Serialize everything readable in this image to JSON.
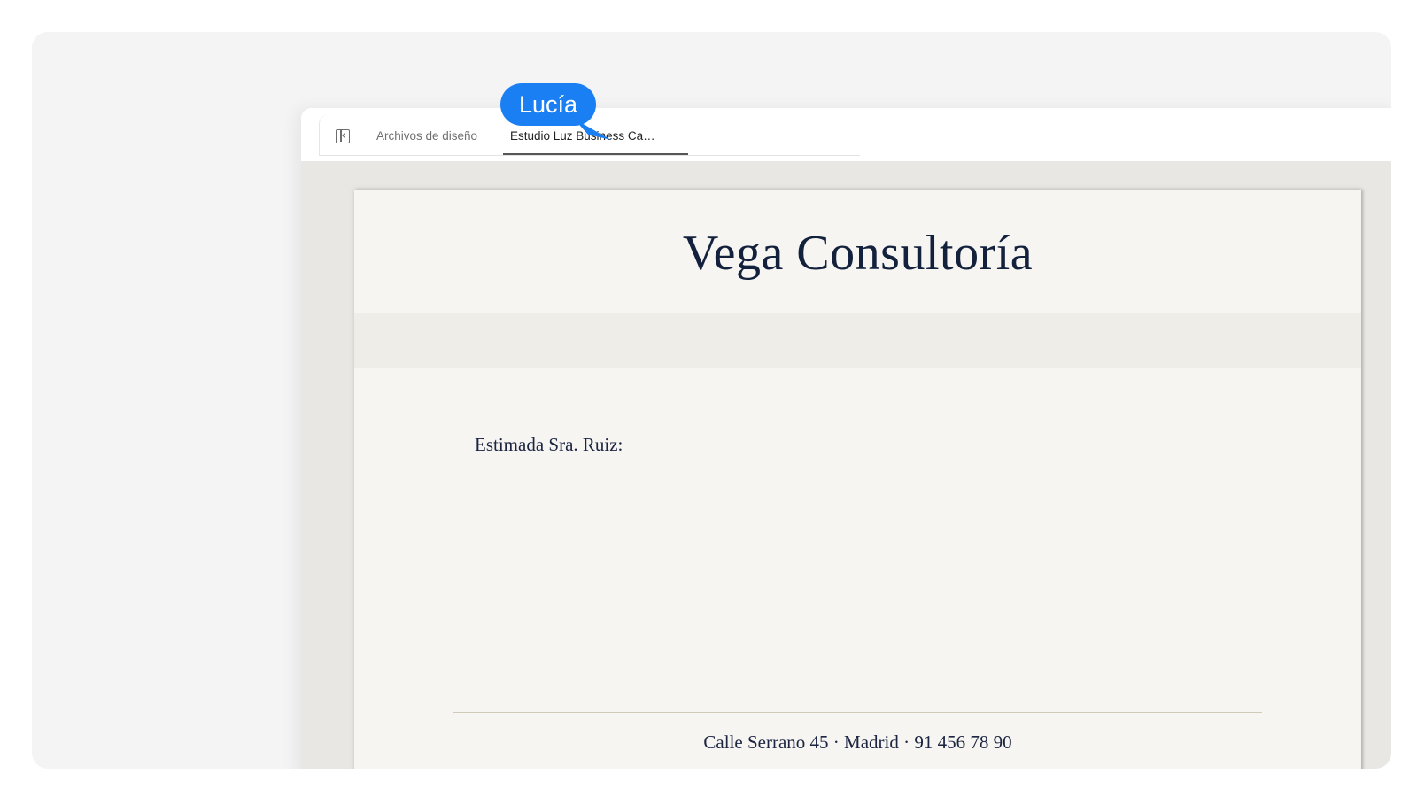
{
  "tabs": {
    "sidebar_toggle_icon": "sidebar-toggle-icon",
    "items": [
      {
        "label": "Archivos de diseño",
        "active": false
      },
      {
        "label": "Estudio Luz Business Ca…",
        "active": true
      }
    ]
  },
  "document": {
    "company_name": "Vega Consultoría",
    "salutation": "Estimada Sra. Ruiz:",
    "footer_address": "Calle Serrano 45 · Madrid · 91 456 78 90"
  },
  "collaborator_cursor": {
    "name": "Lucía",
    "color": "#1b7ff4"
  },
  "colors": {
    "title_ink": "#14213d",
    "paper": "#f6f5f2",
    "canvas": "#e9e7e3"
  }
}
